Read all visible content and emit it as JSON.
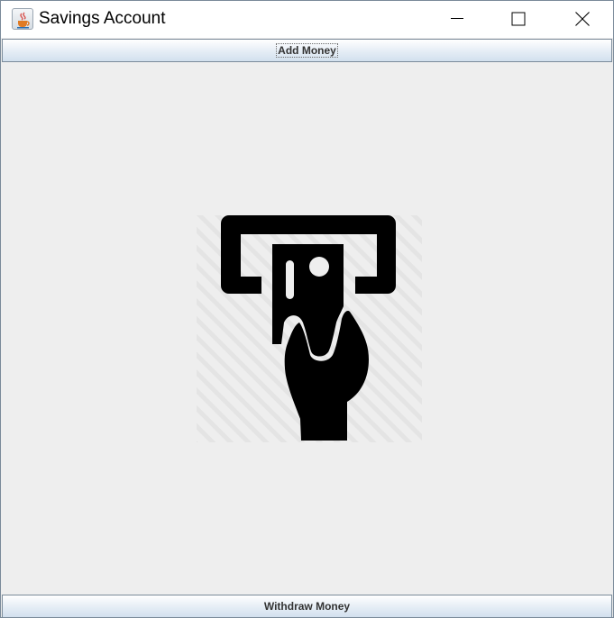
{
  "window": {
    "title": "Savings Account",
    "app_icon": "java-coffee-cup-icon",
    "controls": [
      "minimize-icon",
      "maximize-icon",
      "close-icon"
    ]
  },
  "buttons": {
    "add_money_label": "Add Money",
    "withdraw_money_label": "Withdraw Money"
  },
  "image": {
    "icon": "atm-card-insert-icon"
  },
  "colors": {
    "button_gradient_top": "#ffffff",
    "button_gradient_bottom": "#d2e0ee",
    "panel_background": "#eeeeee",
    "icon_fill": "#000000"
  }
}
